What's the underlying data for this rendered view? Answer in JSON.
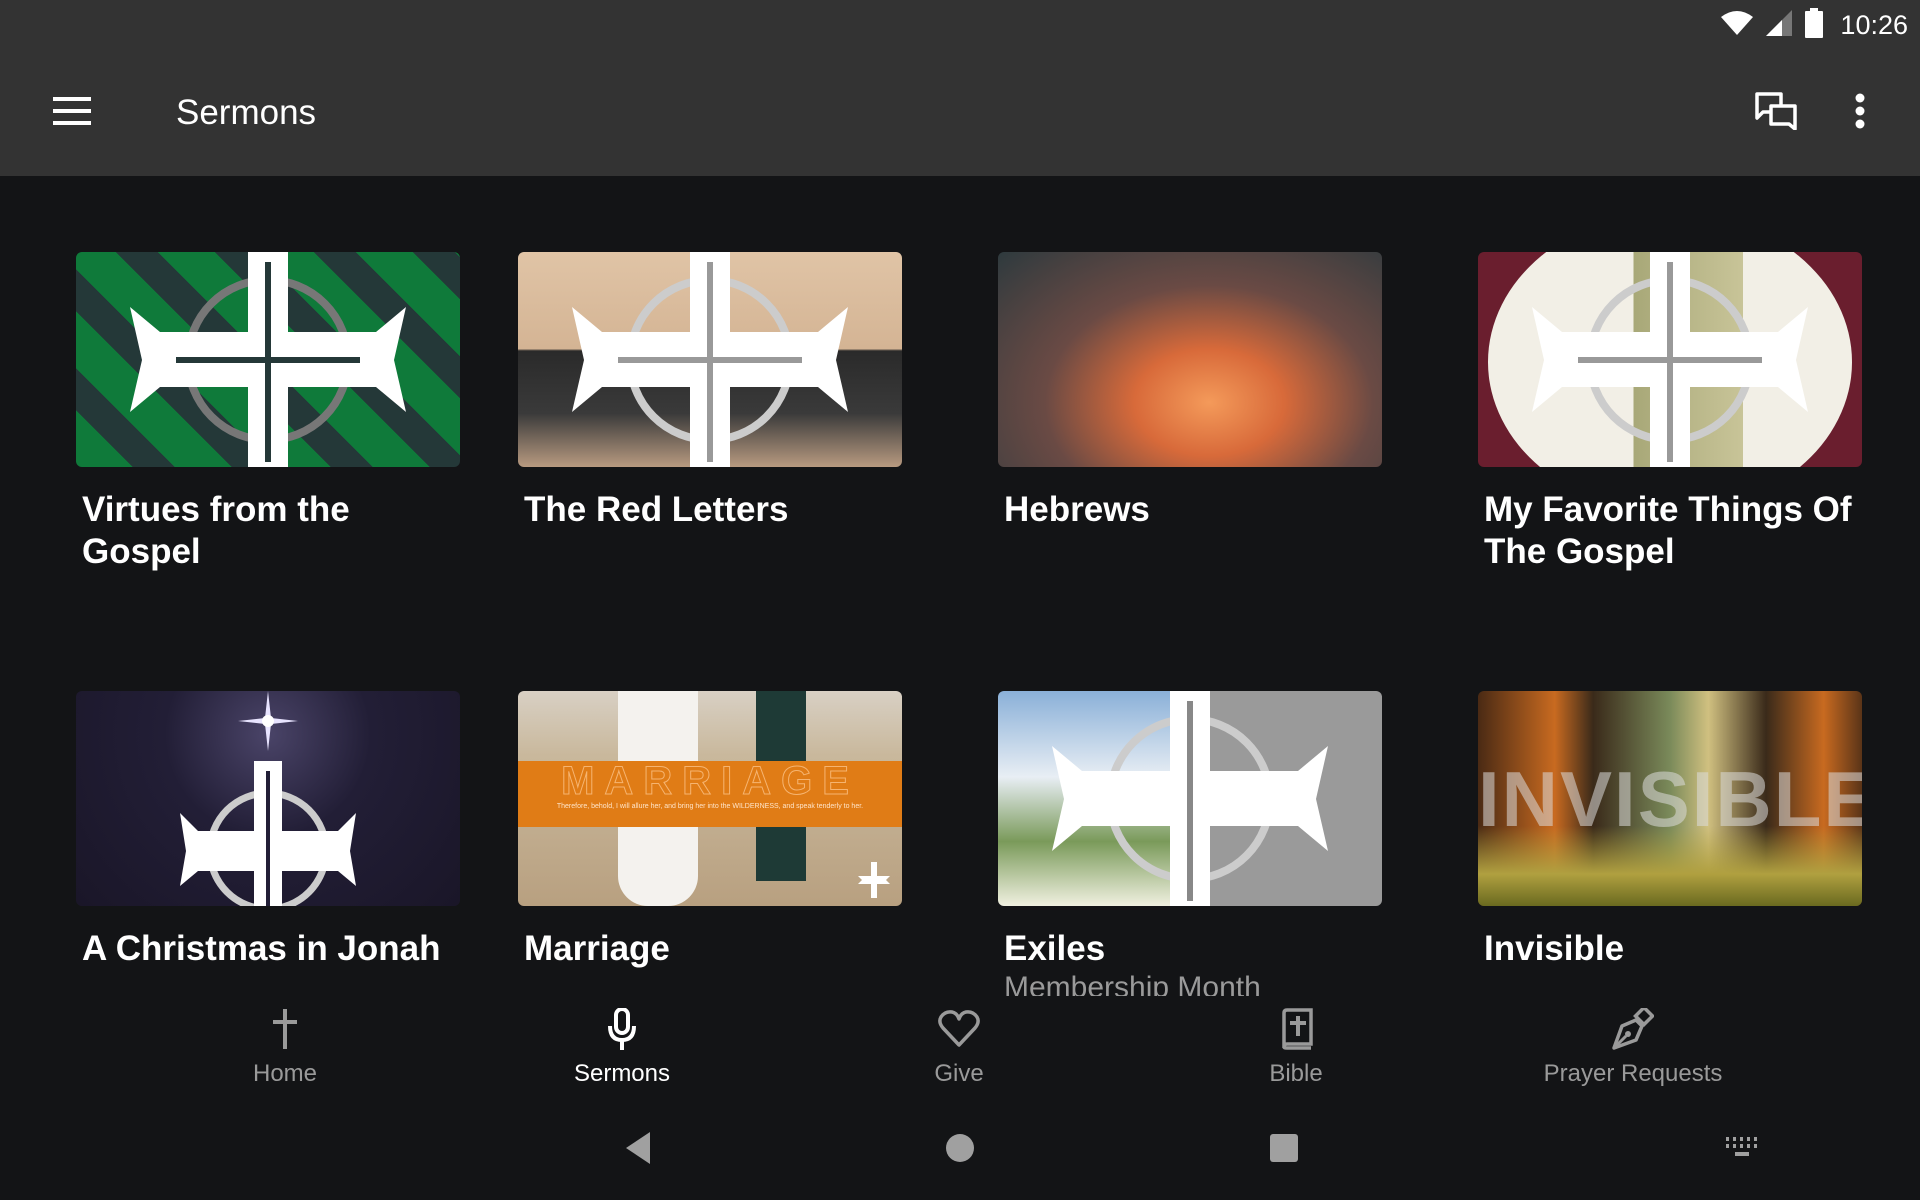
{
  "status_bar": {
    "time": "10:26",
    "icons": [
      "wifi-icon",
      "cell-signal-icon",
      "battery-icon"
    ]
  },
  "app_bar": {
    "title": "Sermons",
    "menu_icon": "hamburger-menu-icon",
    "actions": [
      "chat-icon",
      "more-vert-icon"
    ]
  },
  "sermon_series": [
    {
      "title": "Virtues from the Gospel",
      "subtitle": "",
      "thumb_text": "",
      "colors": [
        "#0f7a3a",
        "#2a3a3a"
      ]
    },
    {
      "title": "The Red Letters",
      "subtitle": "",
      "thumb_text": "",
      "colors": [
        "#d9b89a",
        "#2a2a2a"
      ]
    },
    {
      "title": "Hebrews",
      "subtitle": "",
      "thumb_text": "",
      "colors": [
        "#3a4a4a",
        "#e8824a"
      ]
    },
    {
      "title": "My Favorite Things Of The Gospel",
      "subtitle": "",
      "thumb_text": "",
      "colors": [
        "#6a1e2e",
        "#f2efe6"
      ]
    },
    {
      "title": "A Christmas in Jonah",
      "subtitle": "",
      "thumb_text": "",
      "colors": [
        "#1c1830",
        "#2a2640"
      ]
    },
    {
      "title": "Marriage",
      "subtitle": "",
      "thumb_text": "MARRIAGE",
      "thumb_caption": "Therefore, behold, I will allure her, and bring her into the WILDERNESS, and speak tenderly to her.",
      "colors": [
        "#e07c16",
        "#c9b89c"
      ]
    },
    {
      "title": "Exiles",
      "subtitle": "Membership Month",
      "thumb_text": "",
      "colors": [
        "#8ab0d8",
        "#9a9a9a"
      ]
    },
    {
      "title": "Invisible",
      "subtitle": "",
      "thumb_text": "INVISIBLE",
      "colors": [
        "#5a3418",
        "#c8a040"
      ]
    }
  ],
  "bottom_nav": {
    "items": [
      {
        "label": "Home",
        "icon": "cross-icon",
        "active": false
      },
      {
        "label": "Sermons",
        "icon": "microphone-icon",
        "active": true
      },
      {
        "label": "Give",
        "icon": "heart-icon",
        "active": false
      },
      {
        "label": "Bible",
        "icon": "bible-icon",
        "active": false
      },
      {
        "label": "Prayer Requests",
        "icon": "pen-nib-icon",
        "active": false
      }
    ]
  },
  "system_nav": {
    "buttons": [
      "back-icon",
      "home-circle-icon",
      "recents-square-icon",
      "keyboard-icon"
    ]
  }
}
